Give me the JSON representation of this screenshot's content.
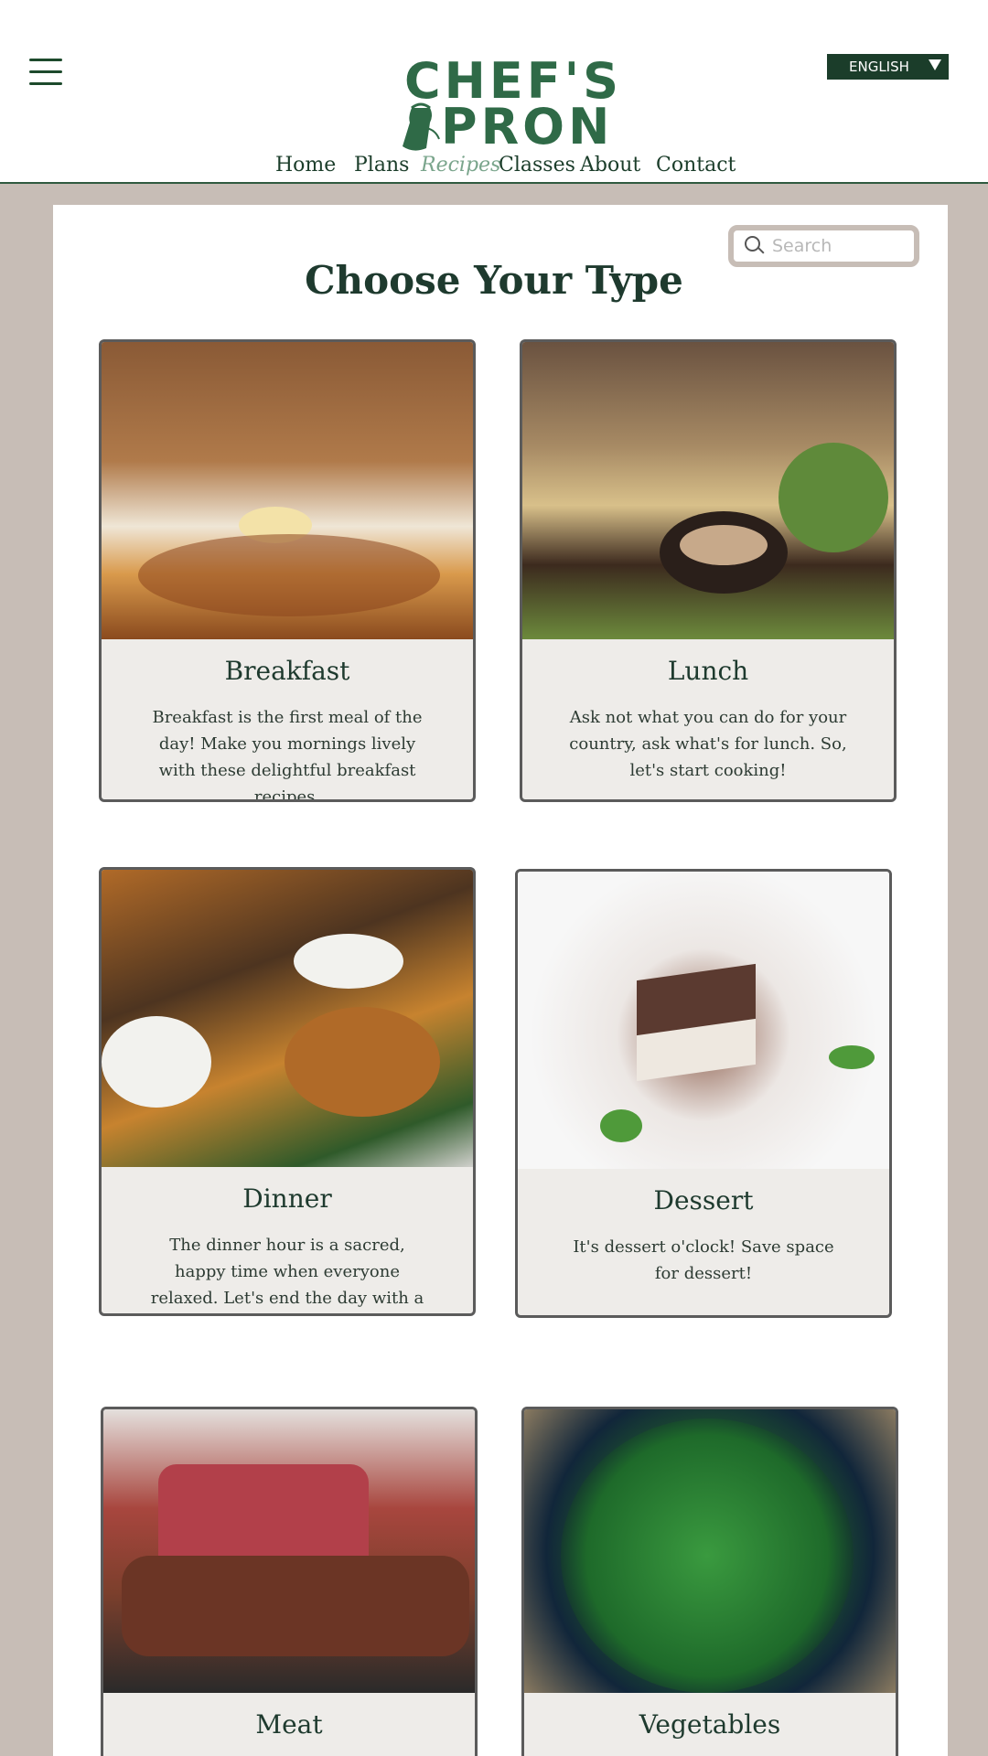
{
  "header": {
    "menu_icon": "hamburger-menu-icon",
    "logo": {
      "line1": "CHEF'S",
      "line2": "PRON"
    },
    "language": "ENGLISH",
    "nav": [
      {
        "label": "Home",
        "active": false
      },
      {
        "label": "Plans",
        "active": false
      },
      {
        "label": "Recipes",
        "active": true
      },
      {
        "label": "Classes",
        "active": false
      },
      {
        "label": "About",
        "active": false
      },
      {
        "label": "Contact",
        "active": false
      }
    ]
  },
  "search": {
    "placeholder": "Search",
    "value": ""
  },
  "main": {
    "title": "Choose Your Type",
    "cards": [
      {
        "name": "Breakfast",
        "desc": "Breakfast is the first meal of the day! Make you mornings lively with these delightful breakfast recipes."
      },
      {
        "name": "Lunch",
        "desc": "Ask not what you can do for your country, ask what's for lunch. So, let's start cooking!"
      },
      {
        "name": "Dinner",
        "desc": "The dinner hour is a sacred, happy time when everyone relaxed. Let's end the day with a delicious and warm meal."
      },
      {
        "name": "Dessert",
        "desc": "It's dessert o'clock! Save space for dessert!"
      },
      {
        "name": "Meat",
        "desc": ""
      },
      {
        "name": "Vegetables",
        "desc": ""
      }
    ]
  },
  "colors": {
    "brand_green": "#2f6a47",
    "dark_green": "#1b3d2a",
    "active_nav": "#7aa58c",
    "page_bg": "#c7bdb6",
    "card_bg": "#eeece9"
  }
}
